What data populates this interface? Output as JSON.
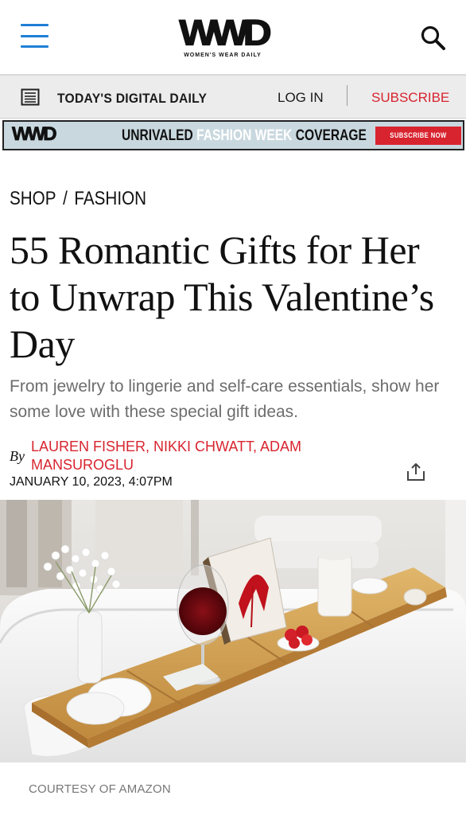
{
  "header": {
    "logo_text": "WWD",
    "logo_subtitle": "WOMEN'S WEAR DAILY",
    "menu_icon": "hamburger-menu-icon",
    "search_icon": "search-icon"
  },
  "daily_bar": {
    "icon": "newspaper-icon",
    "label": "TODAY'S DIGITAL DAILY",
    "login_label": "LOG IN",
    "subscribe_label": "SUBSCRIBE"
  },
  "banner": {
    "logo_text": "WWD",
    "text_before": "UNRIVALED ",
    "text_accent": "FASHION WEEK",
    "text_after": " COVERAGE",
    "button_label": "SUBSCRIBE NOW"
  },
  "breadcrumb": {
    "items": [
      "SHOP",
      "FASHION"
    ],
    "separator": "/"
  },
  "article": {
    "headline": "55 Romantic Gifts for Her to Unwrap This Valentine’s Day",
    "dek": "From jewelry to lingerie and self-care essentials, show her some love with these special gift ideas.",
    "by_label": "By",
    "authors": "LAUREN FISHER, NIKKI CHWATT, ADAM MANSUROGLU",
    "date": "JANUARY 10, 2023, 4:07PM",
    "share_icon": "share-icon",
    "image_caption": "COURTESY OF AMAZON"
  },
  "colors": {
    "accent_red": "#d8242f",
    "menu_blue": "#1f7fd6",
    "banner_bg": "#c9d8df",
    "dek_gray": "#6d6d6d"
  }
}
